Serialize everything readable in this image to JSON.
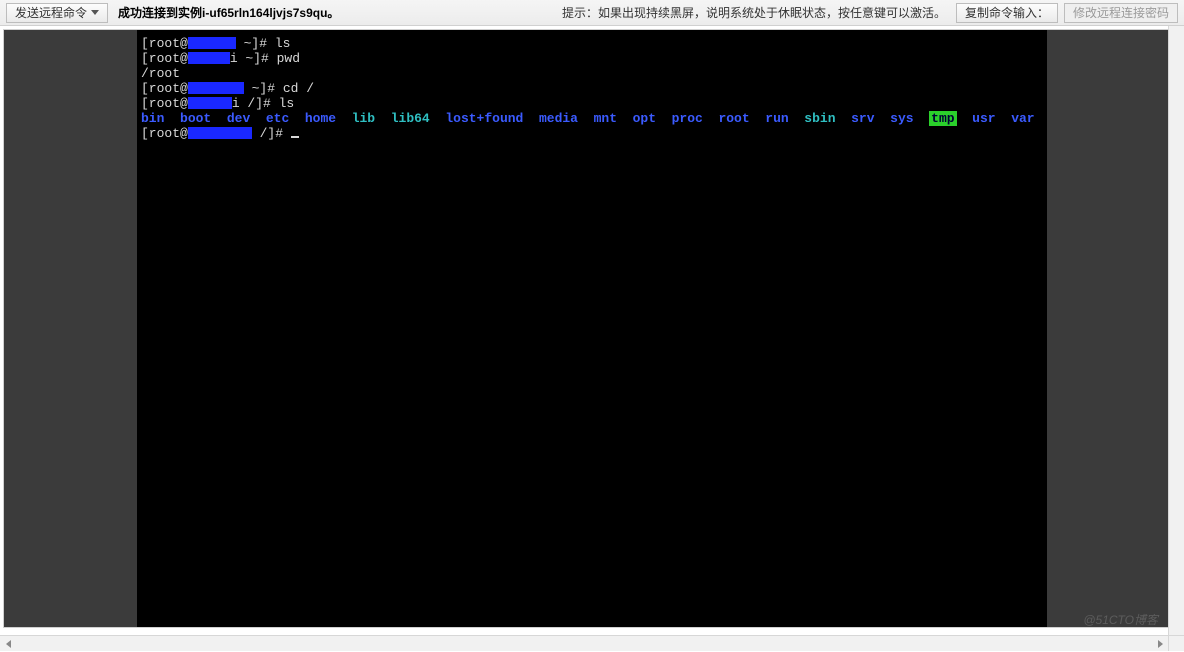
{
  "toolbar": {
    "sendCmdLabel": "发送远程命令",
    "copyInputLabel": "复制命令输入：",
    "changePwdLabel": "修改远程连接密码"
  },
  "status": {
    "prefix": "成功连接到实例",
    "instanceId": "i-uf65rln164ljvjs7s9qu",
    "suffix": "。"
  },
  "hint": "提示：如果出现持续黑屏，说明系统处于休眠状态，按任意键可以激活。",
  "terminal": {
    "promptUser": "root",
    "line1_cmd": "ls",
    "line2_cmd": "pwd",
    "line3_out": "/root",
    "line4_cmd": "cd /",
    "line5_cmd": "ls",
    "dirs_blue_a": [
      "bin",
      "boot",
      "dev",
      "etc",
      "home"
    ],
    "dirs_cyan": [
      "lib",
      "lib64"
    ],
    "dirs_blue_b": [
      "lost+found",
      "media",
      "mnt",
      "opt",
      "proc",
      "root",
      "run"
    ],
    "dirs_cyan2": [
      "sbin"
    ],
    "dirs_blue_c": [
      "srv",
      "sys"
    ],
    "dir_tmp": "tmp",
    "dirs_blue_d": [
      "usr",
      "var"
    ]
  },
  "watermark": "@51CTO博客"
}
